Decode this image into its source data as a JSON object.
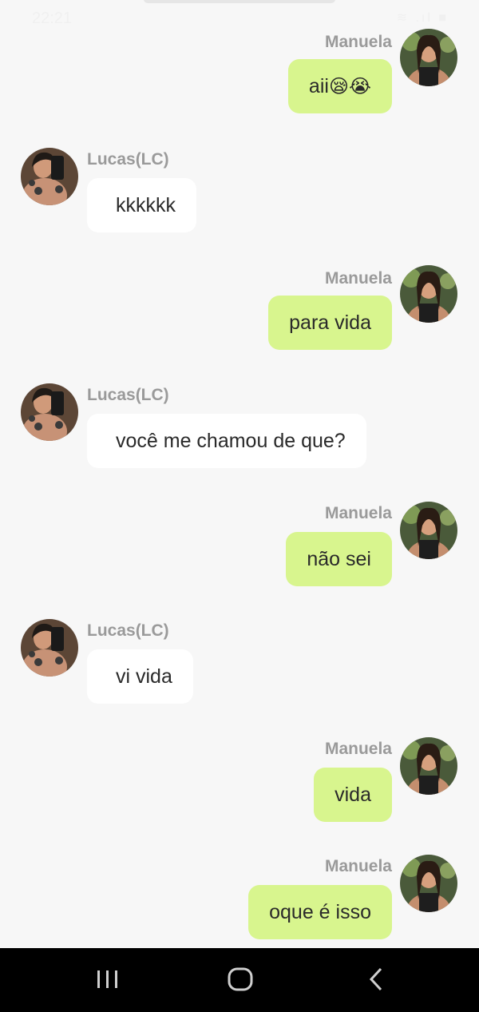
{
  "status_bar": {
    "time": "22:21",
    "icons": "≋ .ıl ■"
  },
  "messages": [
    {
      "side": "right",
      "sender": "Manuela",
      "text": "aii",
      "emoji": "😪😭",
      "avatar": "manuela-avatar"
    },
    {
      "side": "left",
      "sender": "Lucas(LC)",
      "text": "kkkkkk",
      "avatar": "lucas-avatar"
    },
    {
      "side": "right",
      "sender": "Manuela",
      "text": "para vida",
      "avatar": "manuela-avatar"
    },
    {
      "side": "left",
      "sender": "Lucas(LC)",
      "text": "você me chamou de que?",
      "avatar": "lucas-avatar"
    },
    {
      "side": "right",
      "sender": "Manuela",
      "text": "não sei",
      "avatar": "manuela-avatar"
    },
    {
      "side": "left",
      "sender": "Lucas(LC)",
      "text": "vi vida",
      "avatar": "lucas-avatar"
    },
    {
      "side": "right",
      "sender": "Manuela",
      "text": "vida",
      "avatar": "manuela-avatar"
    },
    {
      "side": "right",
      "sender": "Manuela",
      "text": "oque é isso",
      "avatar": "manuela-avatar"
    }
  ],
  "nav_bar": {
    "icons": [
      "recent-apps-icon",
      "home-icon",
      "back-icon"
    ]
  },
  "colors": {
    "sent_bubble": "#d8f58e",
    "received_bubble": "#ffffff",
    "background": "#f7f7f7",
    "name_text": "#9a9a9a"
  }
}
